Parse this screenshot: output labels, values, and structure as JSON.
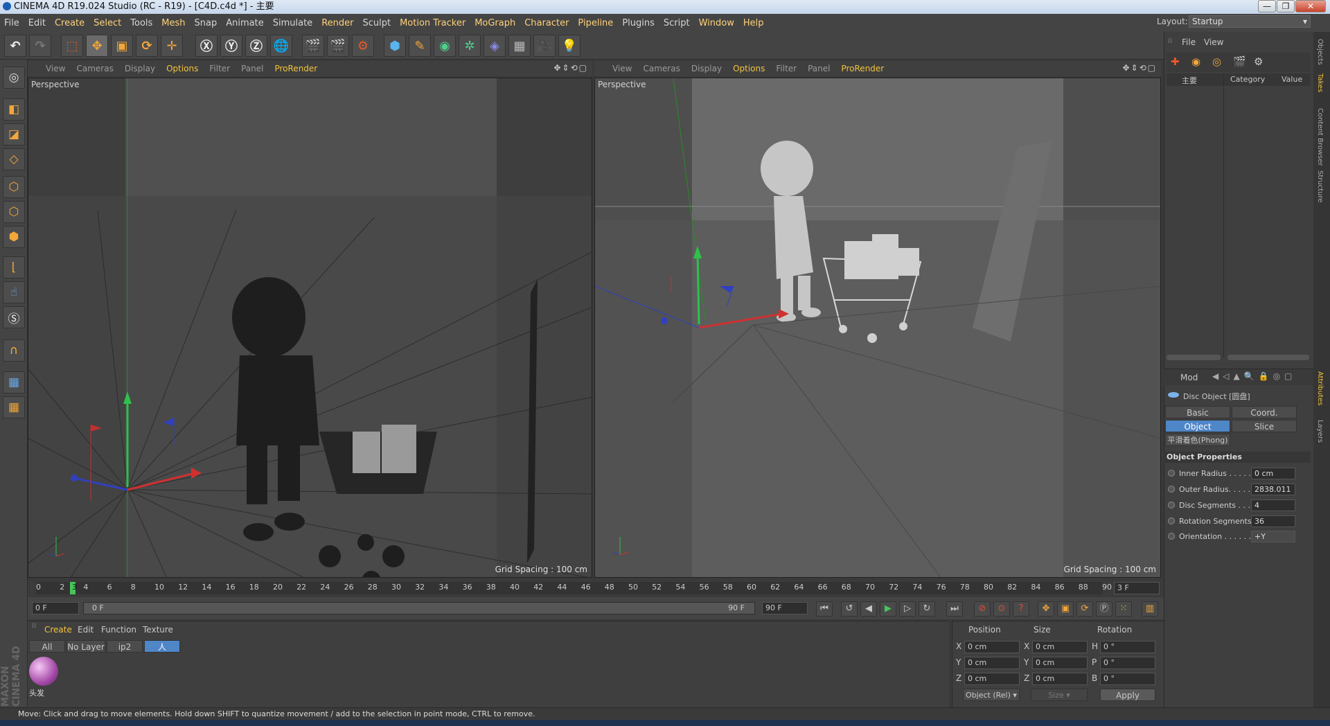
{
  "window": {
    "title": "CINEMA 4D R19.024 Studio (RC - R19) - [C4D.c4d *] - 主要",
    "min": "—",
    "max": "❐",
    "close": "✕"
  },
  "menu": [
    "File",
    "Edit",
    "Create",
    "Select",
    "Tools",
    "Mesh",
    "Snap",
    "Animate",
    "Simulate",
    "Render",
    "Sculpt",
    "Motion Tracker",
    "MoGraph",
    "Character",
    "Pipeline",
    "Plugins",
    "Script",
    "Window",
    "Help"
  ],
  "layout": {
    "label": "Layout:",
    "value": "Startup"
  },
  "viewport_menu": [
    "View",
    "Cameras",
    "Display",
    "Options",
    "Filter",
    "Panel",
    "ProRender"
  ],
  "viewports": [
    {
      "label": "Perspective",
      "grid": "Grid Spacing : 100 cm"
    },
    {
      "label": "Perspective",
      "grid": "Grid Spacing : 100 cm"
    }
  ],
  "timeline": {
    "ticks": [
      "0",
      "2",
      "4",
      "6",
      "8",
      "10",
      "12",
      "14",
      "16",
      "18",
      "20",
      "22",
      "24",
      "26",
      "28",
      "30",
      "32",
      "34",
      "36",
      "38",
      "40",
      "42",
      "44",
      "46",
      "48",
      "50",
      "52",
      "54",
      "56",
      "58",
      "60",
      "62",
      "64",
      "66",
      "68",
      "70",
      "72",
      "74",
      "76",
      "78",
      "80",
      "82",
      "84",
      "86",
      "88",
      "90"
    ],
    "current_marker": "3",
    "current_field": "3 F",
    "start": "0 F",
    "range_start": "0 F",
    "range_end": "90 F",
    "end": "90 F"
  },
  "material_tabs": [
    "Create",
    "Edit",
    "Function",
    "Texture"
  ],
  "layer_tabs": [
    "All",
    "No Layer",
    "ip2",
    "人"
  ],
  "material": {
    "name": "头发"
  },
  "coords": {
    "headers": [
      "Position",
      "Size",
      "Rotation"
    ],
    "rows": [
      {
        "axis": "X",
        "pos": "0 cm",
        "saxis": "X",
        "size": "0 cm",
        "raxis": "H",
        "rot": "0 °"
      },
      {
        "axis": "Y",
        "pos": "0 cm",
        "saxis": "Y",
        "size": "0 cm",
        "raxis": "P",
        "rot": "0 °"
      },
      {
        "axis": "Z",
        "pos": "0 cm",
        "saxis": "Z",
        "size": "0 cm",
        "raxis": "B",
        "rot": "0 °"
      }
    ],
    "mode": "Object (Rel)",
    "size_mode": "Size",
    "apply": "Apply"
  },
  "status": "Move: Click and drag to move elements. Hold down SHIFT to quantize movement / add to the selection in point mode, CTRL to remove.",
  "objects_panel": {
    "menu": [
      "File",
      "View"
    ],
    "tree_item": "主要",
    "col_category": "Category",
    "col_value": "Value"
  },
  "attributes": {
    "mode_label": "Mod",
    "object_title": "Disc Object [圆盘]",
    "tabs": [
      "Basic",
      "Coord.",
      "Object",
      "Slice"
    ],
    "phong_tab": "平滑着色(Phong)",
    "section": "Object Properties",
    "props": [
      {
        "label": "Inner Radius . . . . .",
        "value": "0 cm"
      },
      {
        "label": "Outer Radius. . . . .",
        "value": "2838.011"
      },
      {
        "label": "Disc Segments . . .",
        "value": "4"
      },
      {
        "label": "Rotation Segments",
        "value": "36"
      },
      {
        "label": "Orientation . . . . . .",
        "value": "+Y"
      }
    ]
  },
  "side_tabs": [
    "Objects",
    "Takes",
    "Content Browser",
    "Structure",
    "Attributes",
    "Layers"
  ],
  "brand": "MAXON CINEMA 4D"
}
